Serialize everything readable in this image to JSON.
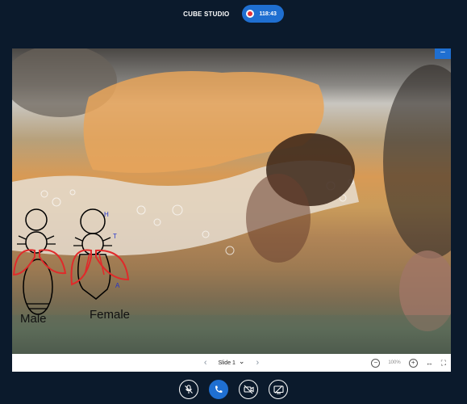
{
  "header": {
    "room_title": "CUBE STUDIO",
    "recording_time": "118:43"
  },
  "presentation": {
    "annotations": {
      "head_label": "H",
      "thorax_label": "T",
      "abdomen_label": "A",
      "male_caption": "Male",
      "female_caption": "Female"
    },
    "minimize_label": "–"
  },
  "slide_bar": {
    "prev_label": "‹",
    "next_label": "›",
    "slide_label": "Slide 1",
    "dropdown_label": "⌄",
    "zoom_out_label": "−",
    "zoom_level": "100%",
    "zoom_in_label": "+",
    "fit_width_label": "↔",
    "fullscreen_label": "⛶"
  },
  "controls": {
    "icons": [
      "microphone-muted-icon",
      "phone-icon",
      "video-off-icon",
      "screenshare-off-icon"
    ]
  },
  "colors": {
    "background": "#0b1a2c",
    "accent": "#1f6fd1",
    "annotation_red": "#e02a2a",
    "annotation_blue": "#2233cc"
  }
}
